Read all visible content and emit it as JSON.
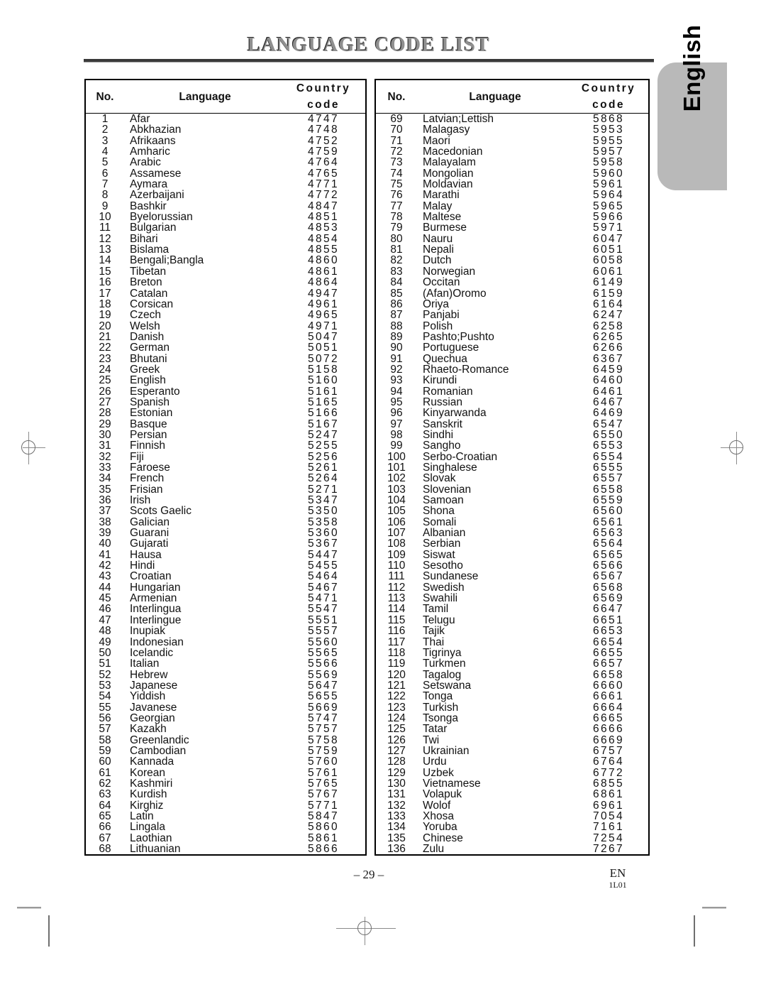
{
  "page": {
    "title": "LANGUAGE CODE LIST",
    "side_tab_label": "English",
    "footer_page_number": "– 29 –",
    "footer_region": "EN",
    "footer_code": "1L01"
  },
  "table": {
    "headers": {
      "no": "No.",
      "language": "Language",
      "country_code": "Country code"
    },
    "left_rows": [
      {
        "no": "1",
        "language": "Afar",
        "code": "4747"
      },
      {
        "no": "2",
        "language": "Abkhazian",
        "code": "4748"
      },
      {
        "no": "3",
        "language": "Afrikaans",
        "code": "4752"
      },
      {
        "no": "4",
        "language": "Amharic",
        "code": "4759"
      },
      {
        "no": "5",
        "language": "Arabic",
        "code": "4764"
      },
      {
        "no": "6",
        "language": "Assamese",
        "code": "4765"
      },
      {
        "no": "7",
        "language": "Aymara",
        "code": "4771"
      },
      {
        "no": "8",
        "language": "Azerbaijani",
        "code": "4772"
      },
      {
        "no": "9",
        "language": "Bashkir",
        "code": "4847"
      },
      {
        "no": "10",
        "language": "Byelorussian",
        "code": "4851"
      },
      {
        "no": "11",
        "language": "Bulgarian",
        "code": "4853"
      },
      {
        "no": "12",
        "language": "Bihari",
        "code": "4854"
      },
      {
        "no": "13",
        "language": "Bislama",
        "code": "4855"
      },
      {
        "no": "14",
        "language": "Bengali;Bangla",
        "code": "4860"
      },
      {
        "no": "15",
        "language": "Tibetan",
        "code": "4861"
      },
      {
        "no": "16",
        "language": "Breton",
        "code": "4864"
      },
      {
        "no": "17",
        "language": "Catalan",
        "code": "4947"
      },
      {
        "no": "18",
        "language": "Corsican",
        "code": "4961"
      },
      {
        "no": "19",
        "language": "Czech",
        "code": "4965"
      },
      {
        "no": "20",
        "language": "Welsh",
        "code": "4971"
      },
      {
        "no": "21",
        "language": "Danish",
        "code": "5047"
      },
      {
        "no": "22",
        "language": "German",
        "code": "5051"
      },
      {
        "no": "23",
        "language": "Bhutani",
        "code": "5072"
      },
      {
        "no": "24",
        "language": "Greek",
        "code": "5158"
      },
      {
        "no": "25",
        "language": "English",
        "code": "5160"
      },
      {
        "no": "26",
        "language": "Esperanto",
        "code": "5161"
      },
      {
        "no": "27",
        "language": "Spanish",
        "code": "5165"
      },
      {
        "no": "28",
        "language": "Estonian",
        "code": "5166"
      },
      {
        "no": "29",
        "language": "Basque",
        "code": "5167"
      },
      {
        "no": "30",
        "language": "Persian",
        "code": "5247"
      },
      {
        "no": "31",
        "language": "Finnish",
        "code": "5255"
      },
      {
        "no": "32",
        "language": "Fiji",
        "code": "5256"
      },
      {
        "no": "33",
        "language": "Faroese",
        "code": "5261"
      },
      {
        "no": "34",
        "language": "French",
        "code": "5264"
      },
      {
        "no": "35",
        "language": "Frisian",
        "code": "5271"
      },
      {
        "no": "36",
        "language": "Irish",
        "code": "5347"
      },
      {
        "no": "37",
        "language": "Scots Gaelic",
        "code": "5350"
      },
      {
        "no": "38",
        "language": "Galician",
        "code": "5358"
      },
      {
        "no": "39",
        "language": "Guarani",
        "code": "5360"
      },
      {
        "no": "40",
        "language": "Gujarati",
        "code": "5367"
      },
      {
        "no": "41",
        "language": "Hausa",
        "code": "5447"
      },
      {
        "no": "42",
        "language": "Hindi",
        "code": "5455"
      },
      {
        "no": "43",
        "language": "Croatian",
        "code": "5464"
      },
      {
        "no": "44",
        "language": "Hungarian",
        "code": "5467"
      },
      {
        "no": "45",
        "language": "Armenian",
        "code": "5471"
      },
      {
        "no": "46",
        "language": "Interlingua",
        "code": "5547"
      },
      {
        "no": "47",
        "language": "Interlingue",
        "code": "5551"
      },
      {
        "no": "48",
        "language": "Inupiak",
        "code": "5557"
      },
      {
        "no": "49",
        "language": "Indonesian",
        "code": "5560"
      },
      {
        "no": "50",
        "language": "Icelandic",
        "code": "5565"
      },
      {
        "no": "51",
        "language": "Italian",
        "code": "5566"
      },
      {
        "no": "52",
        "language": "Hebrew",
        "code": "5569"
      },
      {
        "no": "53",
        "language": "Japanese",
        "code": "5647"
      },
      {
        "no": "54",
        "language": "Yiddish",
        "code": "5655"
      },
      {
        "no": "55",
        "language": "Javanese",
        "code": "5669"
      },
      {
        "no": "56",
        "language": "Georgian",
        "code": "5747"
      },
      {
        "no": "57",
        "language": "Kazakh",
        "code": "5757"
      },
      {
        "no": "58",
        "language": "Greenlandic",
        "code": "5758"
      },
      {
        "no": "59",
        "language": "Cambodian",
        "code": "5759"
      },
      {
        "no": "60",
        "language": "Kannada",
        "code": "5760"
      },
      {
        "no": "61",
        "language": "Korean",
        "code": "5761"
      },
      {
        "no": "62",
        "language": "Kashmiri",
        "code": "5765"
      },
      {
        "no": "63",
        "language": "Kurdish",
        "code": "5767"
      },
      {
        "no": "64",
        "language": "Kirghiz",
        "code": "5771"
      },
      {
        "no": "65",
        "language": "Latin",
        "code": "5847"
      },
      {
        "no": "66",
        "language": "Lingala",
        "code": "5860"
      },
      {
        "no": "67",
        "language": "Laothian",
        "code": "5861"
      },
      {
        "no": "68",
        "language": "Lithuanian",
        "code": "5866"
      }
    ],
    "right_rows": [
      {
        "no": "69",
        "language": "Latvian;Lettish",
        "code": "5868"
      },
      {
        "no": "70",
        "language": "Malagasy",
        "code": "5953"
      },
      {
        "no": "71",
        "language": "Maori",
        "code": "5955"
      },
      {
        "no": "72",
        "language": "Macedonian",
        "code": "5957"
      },
      {
        "no": "73",
        "language": "Malayalam",
        "code": "5958"
      },
      {
        "no": "74",
        "language": "Mongolian",
        "code": "5960"
      },
      {
        "no": "75",
        "language": "Moldavian",
        "code": "5961"
      },
      {
        "no": "76",
        "language": "Marathi",
        "code": "5964"
      },
      {
        "no": "77",
        "language": "Malay",
        "code": "5965"
      },
      {
        "no": "78",
        "language": "Maltese",
        "code": "5966"
      },
      {
        "no": "79",
        "language": "Burmese",
        "code": "5971"
      },
      {
        "no": "80",
        "language": "Nauru",
        "code": "6047"
      },
      {
        "no": "81",
        "language": "Nepali",
        "code": "6051"
      },
      {
        "no": "82",
        "language": "Dutch",
        "code": "6058"
      },
      {
        "no": "83",
        "language": "Norwegian",
        "code": "6061"
      },
      {
        "no": "84",
        "language": "Occitan",
        "code": "6149"
      },
      {
        "no": "85",
        "language": "(Afan)Oromo",
        "code": "6159"
      },
      {
        "no": "86",
        "language": "Oriya",
        "code": "6164"
      },
      {
        "no": "87",
        "language": "Panjabi",
        "code": "6247"
      },
      {
        "no": "88",
        "language": "Polish",
        "code": "6258"
      },
      {
        "no": "89",
        "language": "Pashto;Pushto",
        "code": "6265"
      },
      {
        "no": "90",
        "language": "Portuguese",
        "code": "6266"
      },
      {
        "no": "91",
        "language": "Quechua",
        "code": "6367"
      },
      {
        "no": "92",
        "language": "Rhaeto-Romance",
        "code": "6459"
      },
      {
        "no": "93",
        "language": "Kirundi",
        "code": "6460"
      },
      {
        "no": "94",
        "language": "Romanian",
        "code": "6461"
      },
      {
        "no": "95",
        "language": "Russian",
        "code": "6467"
      },
      {
        "no": "96",
        "language": "Kinyarwanda",
        "code": "6469"
      },
      {
        "no": "97",
        "language": "Sanskrit",
        "code": "6547"
      },
      {
        "no": "98",
        "language": "Sindhi",
        "code": "6550"
      },
      {
        "no": "99",
        "language": "Sangho",
        "code": "6553"
      },
      {
        "no": "100",
        "language": "Serbo-Croatian",
        "code": "6554"
      },
      {
        "no": "101",
        "language": "Singhalese",
        "code": "6555"
      },
      {
        "no": "102",
        "language": "Slovak",
        "code": "6557"
      },
      {
        "no": "103",
        "language": "Slovenian",
        "code": "6558"
      },
      {
        "no": "104",
        "language": "Samoan",
        "code": "6559"
      },
      {
        "no": "105",
        "language": "Shona",
        "code": "6560"
      },
      {
        "no": "106",
        "language": "Somali",
        "code": "6561"
      },
      {
        "no": "107",
        "language": "Albanian",
        "code": "6563"
      },
      {
        "no": "108",
        "language": "Serbian",
        "code": "6564"
      },
      {
        "no": "109",
        "language": "Siswat",
        "code": "6565"
      },
      {
        "no": "110",
        "language": "Sesotho",
        "code": "6566"
      },
      {
        "no": "111",
        "language": "Sundanese",
        "code": "6567"
      },
      {
        "no": "112",
        "language": "Swedish",
        "code": "6568"
      },
      {
        "no": "113",
        "language": "Swahili",
        "code": "6569"
      },
      {
        "no": "114",
        "language": "Tamil",
        "code": "6647"
      },
      {
        "no": "115",
        "language": "Telugu",
        "code": "6651"
      },
      {
        "no": "116",
        "language": "Tajik",
        "code": "6653"
      },
      {
        "no": "117",
        "language": "Thai",
        "code": "6654"
      },
      {
        "no": "118",
        "language": "Tigrinya",
        "code": "6655"
      },
      {
        "no": "119",
        "language": "Turkmen",
        "code": "6657"
      },
      {
        "no": "120",
        "language": "Tagalog",
        "code": "6658"
      },
      {
        "no": "121",
        "language": "Setswana",
        "code": "6660"
      },
      {
        "no": "122",
        "language": "Tonga",
        "code": "6661"
      },
      {
        "no": "123",
        "language": "Turkish",
        "code": "6664"
      },
      {
        "no": "124",
        "language": "Tsonga",
        "code": "6665"
      },
      {
        "no": "125",
        "language": "Tatar",
        "code": "6666"
      },
      {
        "no": "126",
        "language": "Twi",
        "code": "6669"
      },
      {
        "no": "127",
        "language": "Ukrainian",
        "code": "6757"
      },
      {
        "no": "128",
        "language": "Urdu",
        "code": "6764"
      },
      {
        "no": "129",
        "language": "Uzbek",
        "code": "6772"
      },
      {
        "no": "130",
        "language": "Vietnamese",
        "code": "6855"
      },
      {
        "no": "131",
        "language": "Volapuk",
        "code": "6861"
      },
      {
        "no": "132",
        "language": "Wolof",
        "code": "6961"
      },
      {
        "no": "133",
        "language": "Xhosa",
        "code": "7054"
      },
      {
        "no": "134",
        "language": "Yoruba",
        "code": "7161"
      },
      {
        "no": "135",
        "language": "Chinese",
        "code": "7254"
      },
      {
        "no": "136",
        "language": "Zulu",
        "code": "7267"
      }
    ]
  }
}
